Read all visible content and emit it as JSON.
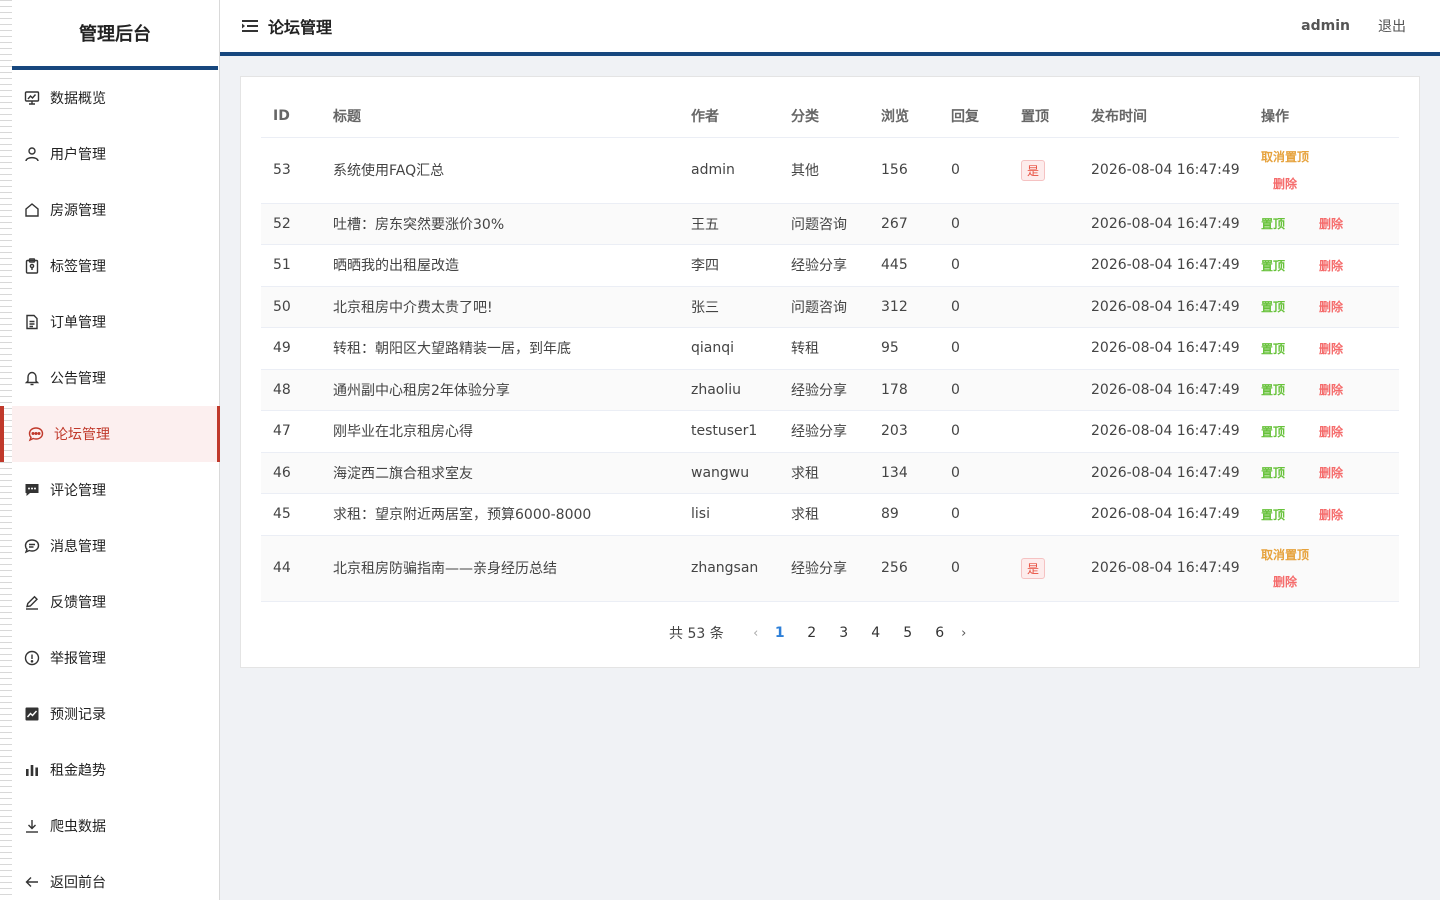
{
  "sidebar": {
    "brand": "管理后台",
    "items": [
      {
        "label": "数据概览",
        "icon": "monitor-chart-icon",
        "name": "sidebar-item-dashboard"
      },
      {
        "label": "用户管理",
        "icon": "user-icon",
        "name": "sidebar-item-users"
      },
      {
        "label": "房源管理",
        "icon": "house-icon",
        "name": "sidebar-item-listings"
      },
      {
        "label": "标签管理",
        "icon": "clipboard-tag-icon",
        "name": "sidebar-item-tags"
      },
      {
        "label": "订单管理",
        "icon": "document-icon",
        "name": "sidebar-item-orders"
      },
      {
        "label": "公告管理",
        "icon": "bell-icon",
        "name": "sidebar-item-notices"
      },
      {
        "label": "论坛管理",
        "icon": "chat-bubble-icon",
        "name": "sidebar-item-forum",
        "active": true
      },
      {
        "label": "评论管理",
        "icon": "comment-icon",
        "name": "sidebar-item-comments"
      },
      {
        "label": "消息管理",
        "icon": "message-icon",
        "name": "sidebar-item-messages"
      },
      {
        "label": "反馈管理",
        "icon": "pen-icon",
        "name": "sidebar-item-feedback"
      },
      {
        "label": "举报管理",
        "icon": "alert-circle-icon",
        "name": "sidebar-item-reports"
      },
      {
        "label": "预测记录",
        "icon": "trend-chart-icon",
        "name": "sidebar-item-predictions"
      },
      {
        "label": "租金趋势",
        "icon": "bar-chart-icon",
        "name": "sidebar-item-rent-trend"
      },
      {
        "label": "爬虫数据",
        "icon": "download-icon",
        "name": "sidebar-item-crawler"
      },
      {
        "label": "返回前台",
        "icon": "arrow-left-icon",
        "name": "sidebar-item-back"
      }
    ]
  },
  "header": {
    "title": "论坛管理",
    "user": "admin",
    "logout": "退出"
  },
  "table": {
    "columns": [
      "ID",
      "标题",
      "作者",
      "分类",
      "浏览",
      "回复",
      "置顶",
      "发布时间",
      "操作"
    ],
    "rows": [
      {
        "id": "53",
        "title": "系统使用FAQ汇总",
        "author": "admin",
        "category": "其他",
        "views": "156",
        "replies": "0",
        "pinned": "是",
        "time": "2026-08-04 16:47:49"
      },
      {
        "id": "52",
        "title": "吐槽：房东突然要涨价30%",
        "author": "王五",
        "category": "问题咨询",
        "views": "267",
        "replies": "0",
        "pinned": "",
        "time": "2026-08-04 16:47:49"
      },
      {
        "id": "51",
        "title": "晒晒我的出租屋改造",
        "author": "李四",
        "category": "经验分享",
        "views": "445",
        "replies": "0",
        "pinned": "",
        "time": "2026-08-04 16:47:49"
      },
      {
        "id": "50",
        "title": "北京租房中介费太贵了吧!",
        "author": "张三",
        "category": "问题咨询",
        "views": "312",
        "replies": "0",
        "pinned": "",
        "time": "2026-08-04 16:47:49"
      },
      {
        "id": "49",
        "title": "转租：朝阳区大望路精装一居，到年底",
        "author": "qianqi",
        "category": "转租",
        "views": "95",
        "replies": "0",
        "pinned": "",
        "time": "2026-08-04 16:47:49"
      },
      {
        "id": "48",
        "title": "通州副中心租房2年体验分享",
        "author": "zhaoliu",
        "category": "经验分享",
        "views": "178",
        "replies": "0",
        "pinned": "",
        "time": "2026-08-04 16:47:49"
      },
      {
        "id": "47",
        "title": "刚毕业在北京租房心得",
        "author": "testuser1",
        "category": "经验分享",
        "views": "203",
        "replies": "0",
        "pinned": "",
        "time": "2026-08-04 16:47:49"
      },
      {
        "id": "46",
        "title": "海淀西二旗合租求室友",
        "author": "wangwu",
        "category": "求租",
        "views": "134",
        "replies": "0",
        "pinned": "",
        "time": "2026-08-04 16:47:49"
      },
      {
        "id": "45",
        "title": "求租：望京附近两居室，预算6000-8000",
        "author": "lisi",
        "category": "求租",
        "views": "89",
        "replies": "0",
        "pinned": "",
        "time": "2026-08-04 16:47:49"
      },
      {
        "id": "44",
        "title": "北京租房防骗指南——亲身经历总结",
        "author": "zhangsan",
        "category": "经验分享",
        "views": "256",
        "replies": "0",
        "pinned": "是",
        "time": "2026-08-04 16:47:49"
      }
    ],
    "ops": {
      "pin": "置顶",
      "unpin": "取消置顶",
      "delete": "删除"
    }
  },
  "pagination": {
    "total": "共 53 条",
    "prev": "‹",
    "next": "›",
    "pages": [
      "1",
      "2",
      "3",
      "4",
      "5",
      "6"
    ],
    "current": "1"
  },
  "colors": {
    "accent": "#17477e",
    "active": "#c0392b",
    "pin": "#67c23a",
    "unpin": "#e6a23c",
    "delete": "#f56c6c",
    "page_active": "#2d7fd8"
  }
}
